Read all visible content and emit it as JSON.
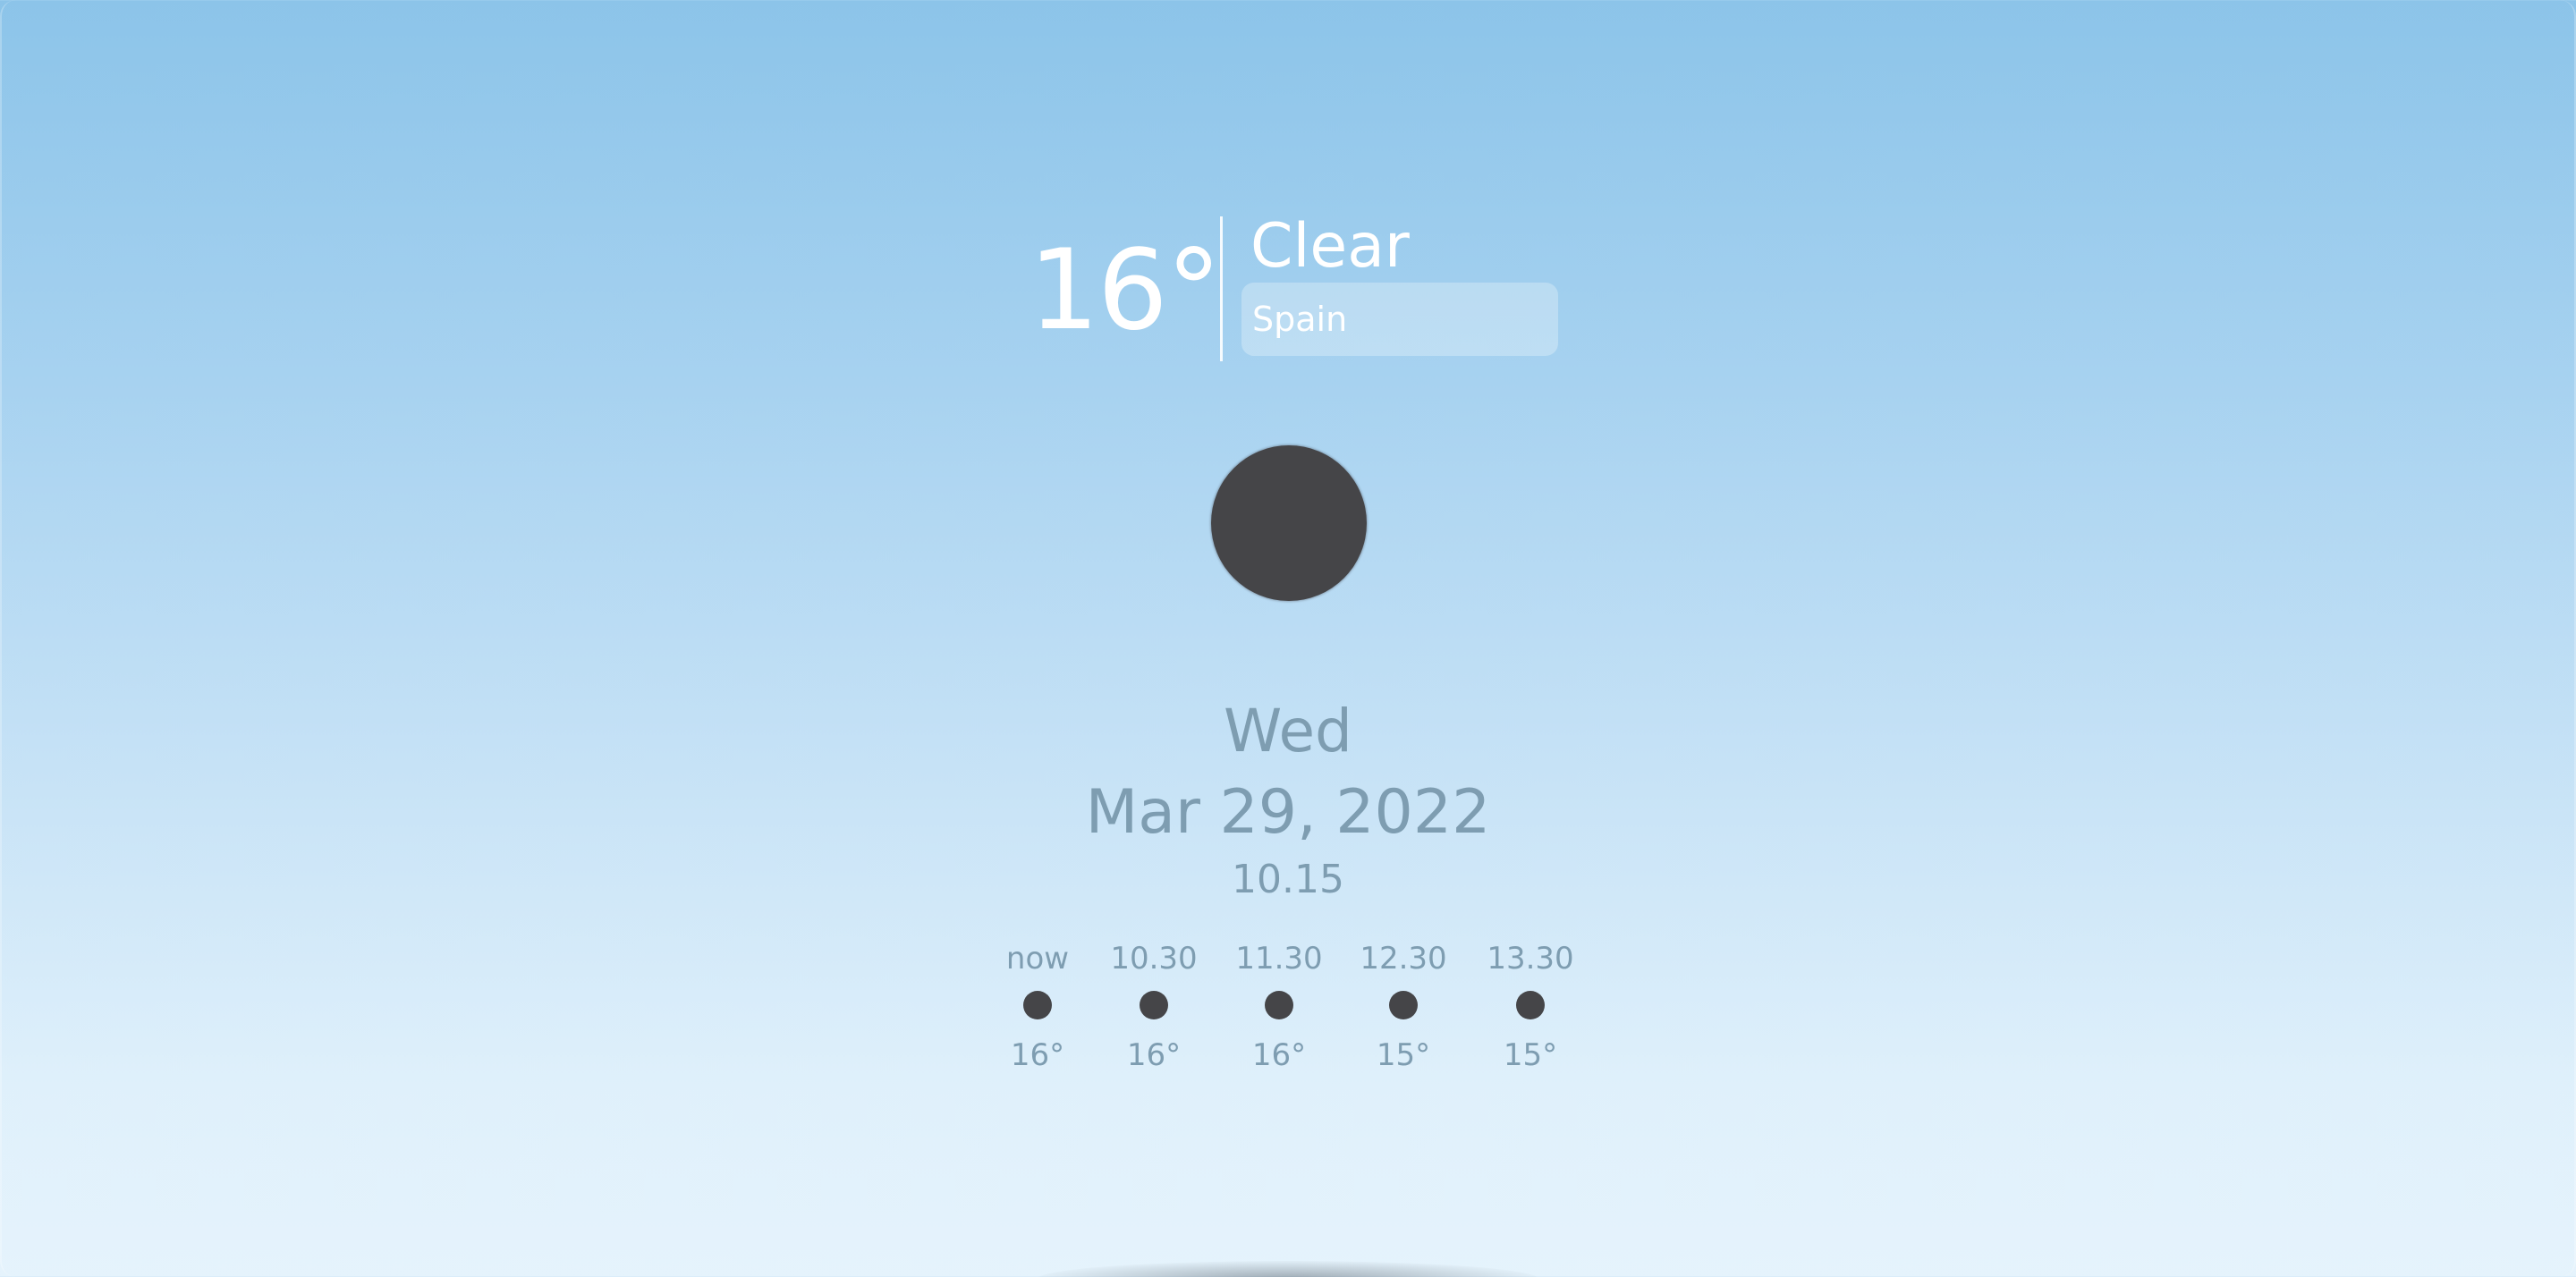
{
  "current": {
    "temperature": "16°",
    "condition": "Clear",
    "icon": "weather-dot-icon"
  },
  "search": {
    "value": "Spain",
    "placeholder": ""
  },
  "date": {
    "weekday": "Wed",
    "full_date": "Mar 29, 2022",
    "time": "10.15"
  },
  "forecast": [
    {
      "label": "now",
      "temp": "16°",
      "icon": "weather-dot-icon"
    },
    {
      "label": "10.30",
      "temp": "16°",
      "icon": "weather-dot-icon"
    },
    {
      "label": "11.30",
      "temp": "16°",
      "icon": "weather-dot-icon"
    },
    {
      "label": "12.30",
      "temp": "15°",
      "icon": "weather-dot-icon"
    },
    {
      "label": "13.30",
      "temp": "15°",
      "icon": "weather-dot-icon"
    }
  ],
  "colors": {
    "sky_top": "#8cc4e9",
    "sky_bottom": "#e5f3fc",
    "secondary_text": "#7e9db1",
    "icon_fill": "#454548"
  }
}
